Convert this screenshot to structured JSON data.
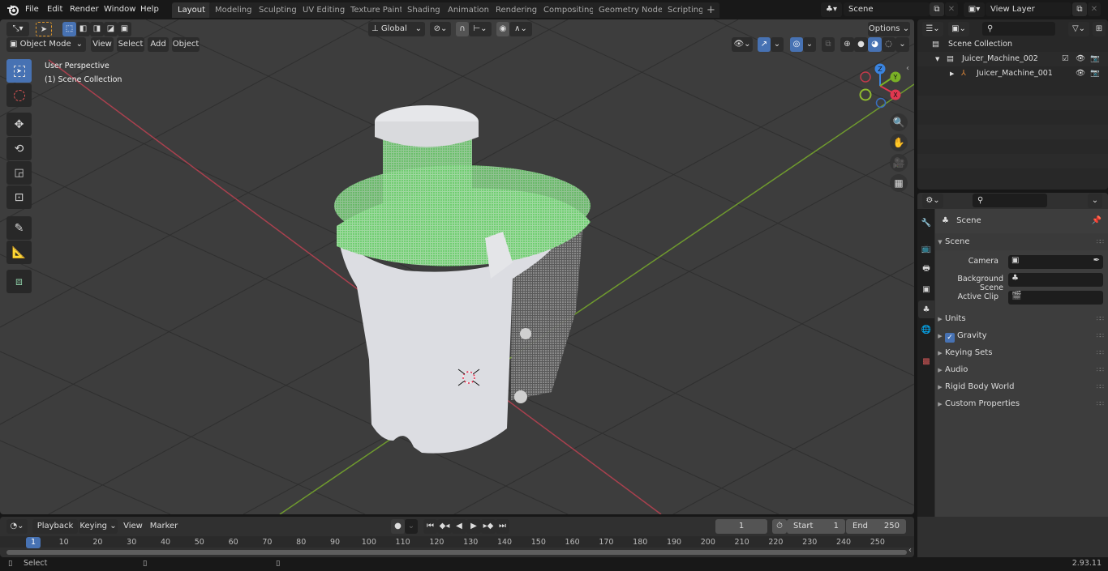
{
  "topbar": {
    "menus": [
      "File",
      "Edit",
      "Render",
      "Window",
      "Help"
    ],
    "workspaces": [
      {
        "label": "Layout",
        "active": true
      },
      {
        "label": "Modeling",
        "active": false
      },
      {
        "label": "Sculpting",
        "active": false
      },
      {
        "label": "UV Editing",
        "active": false
      },
      {
        "label": "Texture Paint",
        "active": false
      },
      {
        "label": "Shading",
        "active": false
      },
      {
        "label": "Animation",
        "active": false
      },
      {
        "label": "Rendering",
        "active": false
      },
      {
        "label": "Compositing",
        "active": false
      },
      {
        "label": "Geometry Nodes",
        "active": false
      },
      {
        "label": "Scripting",
        "active": false
      }
    ],
    "add_workspace": "+",
    "scene_name": "Scene",
    "view_layer_name": "View Layer"
  },
  "viewport": {
    "mode": "Object Mode",
    "menus": [
      "View",
      "Select",
      "Add",
      "Object"
    ],
    "transform_orientation": "Global",
    "options_label": "Options",
    "overlay_text": {
      "line1": "User Perspective",
      "line2": "(1) Scene Collection"
    },
    "gizmo_axes": {
      "x": "X",
      "y": "Y",
      "z": "Z"
    },
    "colors": {
      "x_axis": "#e0384f",
      "y_axis": "#7ab026",
      "z_axis": "#3a84e0",
      "selection_green": "#2bd12b",
      "accent": "#4772b3"
    },
    "tools": [
      "select-box",
      "cursor",
      "move",
      "rotate",
      "scale",
      "transform",
      "annotate",
      "measure",
      "add-cube"
    ],
    "nav_buttons": [
      "zoom",
      "pan",
      "camera",
      "orthographic-toggle"
    ]
  },
  "outliner": {
    "root": "Scene Collection",
    "items": [
      {
        "label": "Juicer_Machine_002",
        "type": "collection",
        "expanded": true,
        "checked": true
      },
      {
        "label": "Juicer_Machine_001",
        "type": "empty",
        "expanded": false
      }
    ]
  },
  "properties": {
    "context": "Scene",
    "section": "Scene",
    "fields": [
      {
        "label": "Camera",
        "value": ""
      },
      {
        "label": "Background Scene",
        "value": ""
      },
      {
        "label": "Active Clip",
        "value": ""
      }
    ],
    "panels": [
      {
        "label": "Units",
        "checkbox": false
      },
      {
        "label": "Gravity",
        "checkbox": true,
        "checked": true
      },
      {
        "label": "Keying Sets",
        "checkbox": false
      },
      {
        "label": "Audio",
        "checkbox": false
      },
      {
        "label": "Rigid Body World",
        "checkbox": false
      },
      {
        "label": "Custom Properties",
        "checkbox": false
      }
    ]
  },
  "timeline": {
    "menus": [
      "Playback",
      "Keying",
      "View",
      "Marker"
    ],
    "current_frame": "1",
    "start_label": "Start",
    "start": "1",
    "end_label": "End",
    "end": "250",
    "ticks": [
      "10",
      "20",
      "30",
      "40",
      "50",
      "60",
      "70",
      "80",
      "90",
      "100",
      "110",
      "120",
      "130",
      "140",
      "150",
      "160",
      "170",
      "180",
      "190",
      "200",
      "210",
      "220",
      "230",
      "240",
      "250"
    ],
    "playhead": "1"
  },
  "statusbar": {
    "left_action": "Select",
    "version": "2.93.11"
  }
}
